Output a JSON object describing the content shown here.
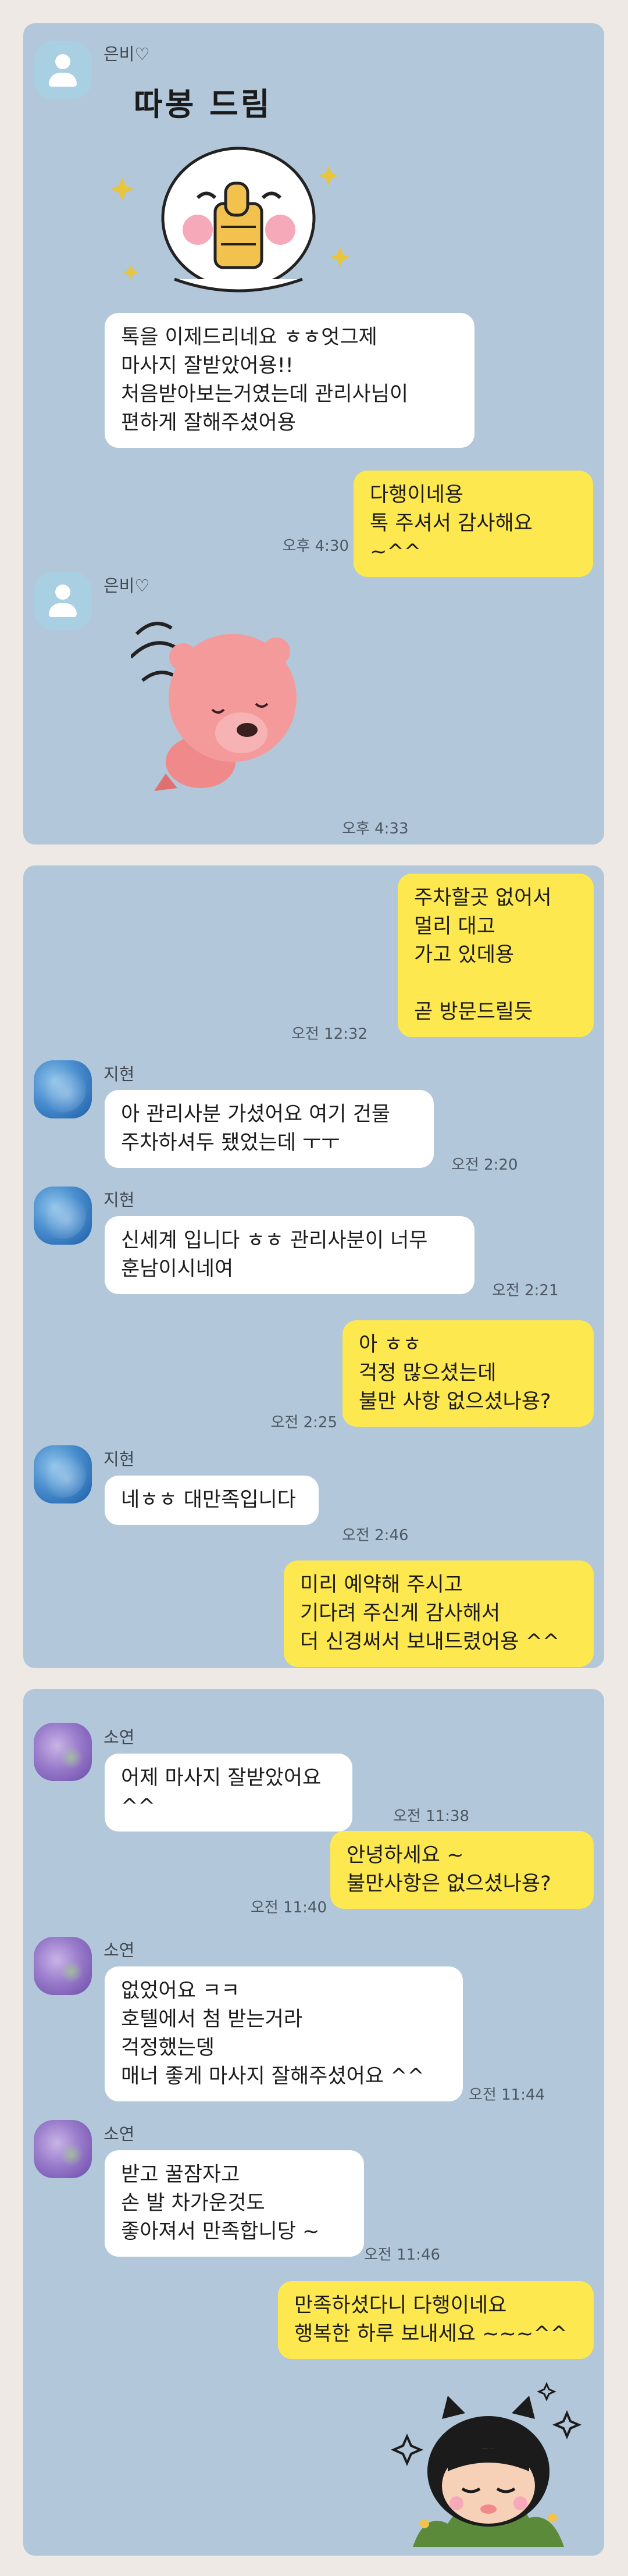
{
  "panels": [
    {
      "messages": [
        {
          "sender": "은비♡",
          "sticker_caption": "따봉 드림"
        },
        {
          "text": "톡을 이제드리네요 ㅎㅎ엇그제\n마사지 잘받았어용!!\n처음받아보는거였는데 관리사님이\n편하게 잘해주셨어용"
        },
        {
          "text": "다행이네용\n톡 주셔서 감사해요 ~^^",
          "time": "오후 4:30"
        },
        {
          "sender": "은비♡",
          "time": "오후 4:33"
        }
      ]
    },
    {
      "messages": [
        {
          "text": "주차할곳 없어서\n멀리 대고\n가고 있데용\n\n곧 방문드릴듯",
          "time": "오전 12:32"
        },
        {
          "sender": "지현",
          "text": "아 관리사분 가셨어요 여기 건물\n주차하셔두 됐었는데 ㅜㅜ",
          "time": "오전 2:20"
        },
        {
          "sender": "지현",
          "text": "신세계 입니다 ㅎㅎ 관리사분이 너무\n훈남이시네여",
          "time": "오전 2:21"
        },
        {
          "text": "아 ㅎㅎ\n걱정 많으셨는데\n불만 사항 없으셨나용?",
          "time": "오전 2:25"
        },
        {
          "sender": "지현",
          "text": "네ㅎㅎ 대만족입니다",
          "time": "오전 2:46"
        },
        {
          "text": "미리 예약해 주시고\n기다려 주신게 감사해서\n더 신경써서 보내드렸어용 ^^"
        }
      ]
    },
    {
      "messages": [
        {
          "sender": "소연",
          "text": "어제 마사지 잘받았어요 ^^",
          "time": "오전 11:38"
        },
        {
          "text": "안녕하세요 ~\n불만사항은 없으셨나용?",
          "time": "오전 11:40"
        },
        {
          "sender": "소연",
          "text": "없었어요 ㅋㅋ\n호텔에서 첨 받는거라\n걱정했는뎅\n매너 좋게 마사지 잘해주셨어요 ^^",
          "time": "오전 11:44"
        },
        {
          "sender": "소연",
          "text": "받고 꿀잠자고\n손 발 차가운것도\n좋아져서 만족합니당 ~",
          "time": "오전 11:46"
        },
        {
          "text": "만족하셨다니 다행이네요\n행복한 하루 보내세요 ~~~^^"
        }
      ]
    }
  ],
  "colors": {
    "page_bg": "#efe9e6",
    "chat_bg": "#b2c7d9",
    "my_bubble": "#fde84f",
    "their_bubble": "#ffffff"
  },
  "icons": {
    "default_avatar": "person-silhouette-icon",
    "sticker_1": "thumbs-up-character-sticker",
    "sticker_2": "pink-beaver-sticker",
    "sticker_3": "kakao-frodo-character-sticker"
  }
}
